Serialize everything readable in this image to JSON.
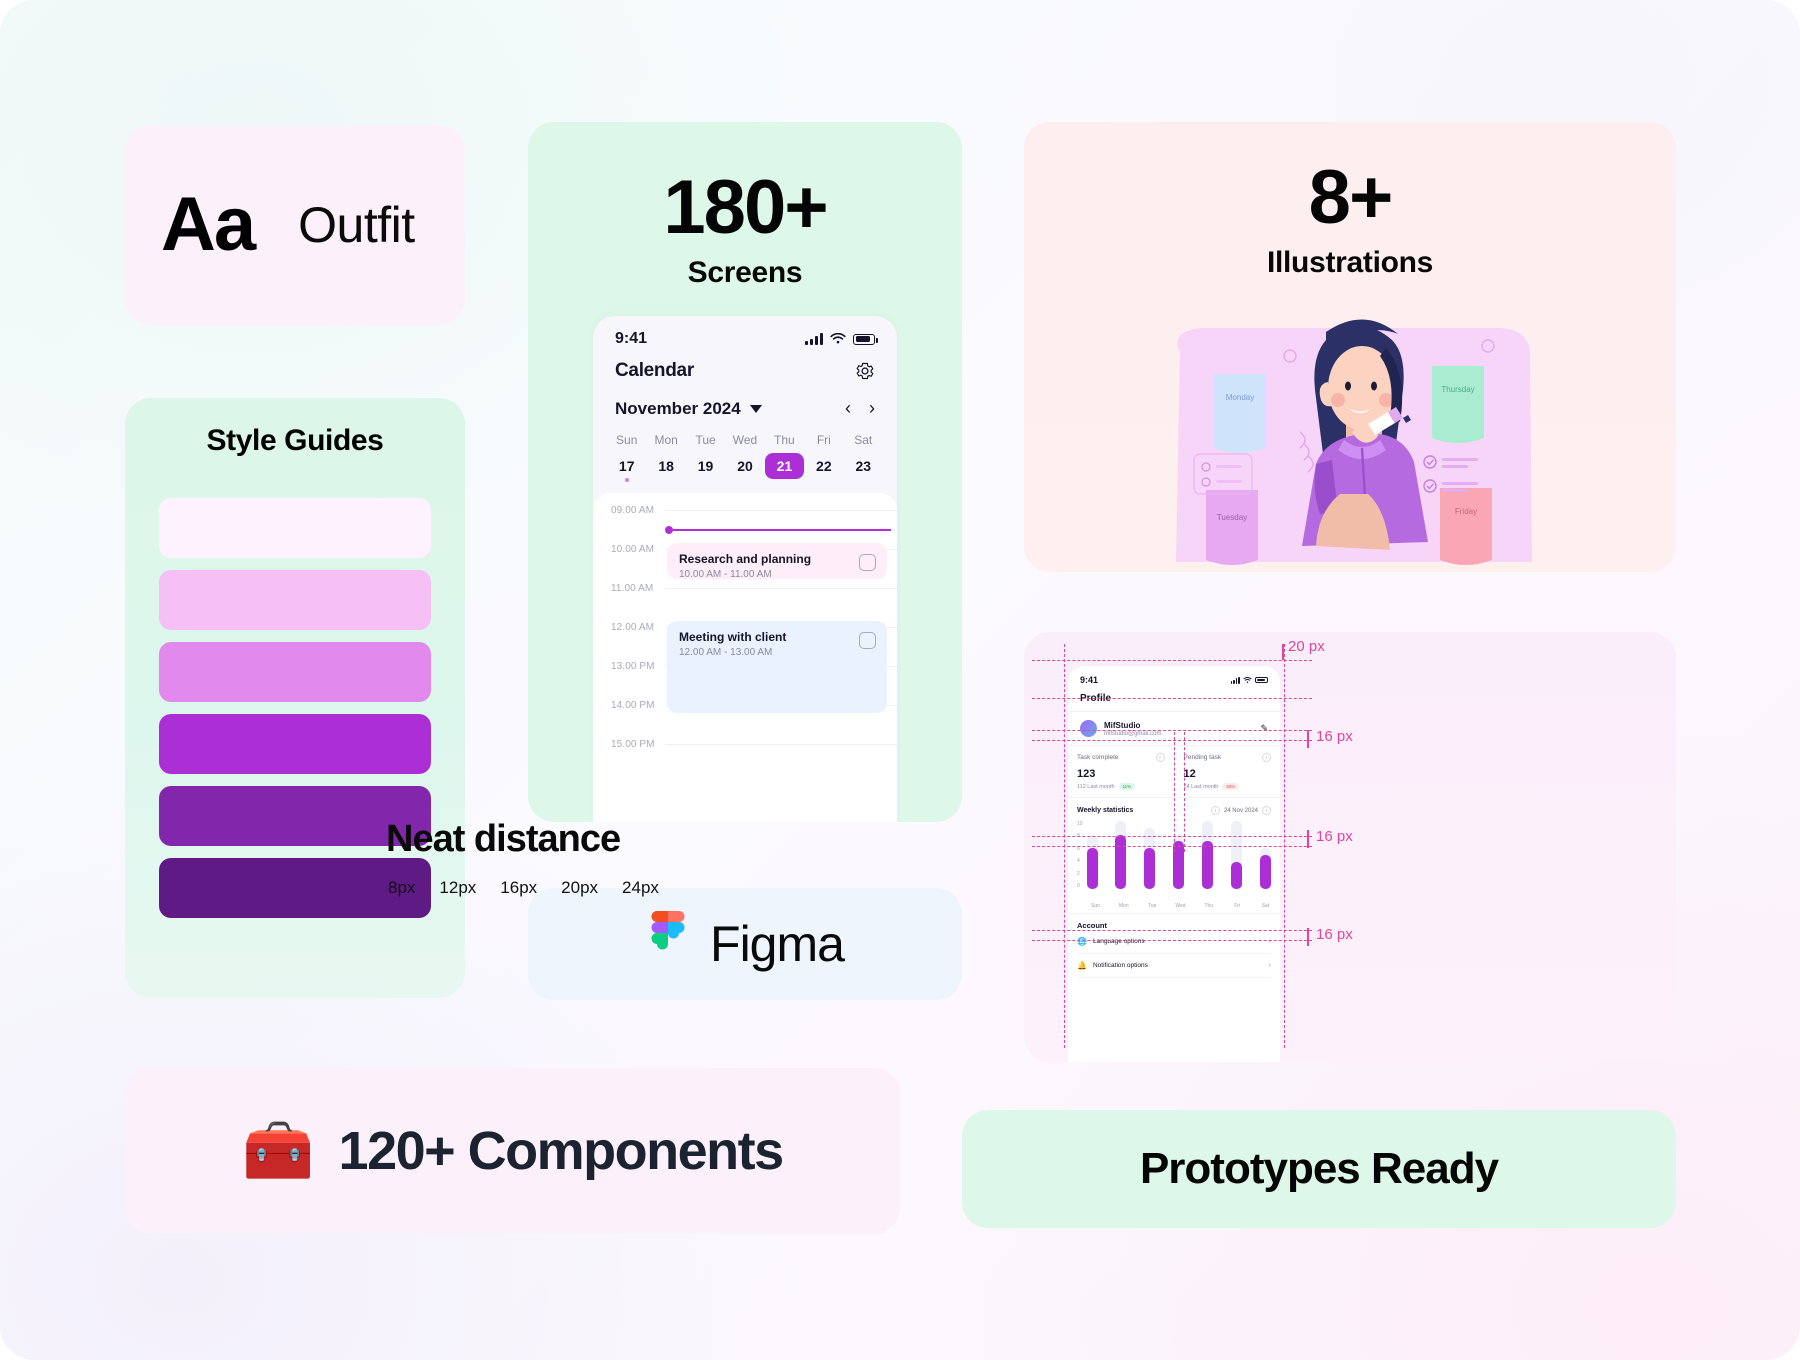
{
  "font_card": {
    "sample": "Aa",
    "name": "Outfit"
  },
  "style_card": {
    "title": "Style Guides",
    "swatches": [
      {
        "name": "purple-50",
        "hex": "#fdf2fd"
      },
      {
        "name": "purple-200",
        "hex": "#f6c0f6"
      },
      {
        "name": "purple-300",
        "hex": "#e189ec"
      },
      {
        "name": "purple-500",
        "hex": "#ab2fd5"
      },
      {
        "name": "purple-700",
        "hex": "#8227ab"
      },
      {
        "name": "purple-900",
        "hex": "#5f1a85"
      }
    ]
  },
  "screens_card": {
    "count": "180+",
    "label": "Screens",
    "phone": {
      "status": {
        "time": "9:41"
      },
      "title": "Calendar",
      "settings_icon": "gear-icon",
      "month": "November  2024",
      "day_names": [
        "Sun",
        "Mon",
        "Tue",
        "Wed",
        "Thu",
        "Fri",
        "Sat"
      ],
      "day_numbers": [
        "17",
        "18",
        "19",
        "20",
        "21",
        "22",
        "23"
      ],
      "selected_day": "21",
      "time_slots": [
        "09.00 AM",
        "10.00 AM",
        "11.00 AM",
        "12.00 AM",
        "13.00 PM",
        "14.00 PM",
        "15.00 PM"
      ],
      "events": [
        {
          "title": "Research and planning",
          "time": "10.00 AM - 11.00 AM",
          "color": "pink"
        },
        {
          "title": "Meeting with client",
          "time": "12.00 AM - 13.00 AM",
          "color": "blue"
        }
      ]
    }
  },
  "figma_card": {
    "label": "Figma",
    "logo": "figma-logo"
  },
  "illustrations_card": {
    "count": "8+",
    "label": "Illustrations",
    "sticky_notes": [
      "Monday",
      "Thursday",
      "Tuesday",
      "Friday"
    ]
  },
  "neat_card": {
    "title": "Neat distance",
    "spacing_values": [
      "8px",
      "12px",
      "16px",
      "20px",
      "24px"
    ],
    "annotations": [
      "20 px",
      "16 px",
      "16 px",
      "16 px"
    ],
    "phone": {
      "status": {
        "time": "9:41"
      },
      "title": "Profile",
      "user": {
        "name": "MifStudio",
        "email": "mifstudio@gmail.com",
        "edit_icon": "pencil-icon"
      },
      "stats": [
        {
          "label": "Task complete",
          "value": "123",
          "sub": "112 Last month",
          "delta": "11%",
          "direction": "up"
        },
        {
          "label": "Pending task",
          "value": "12",
          "sub": "24 Last month",
          "delta": "50%",
          "direction": "down"
        }
      ],
      "chart_title": "Weekly statistics",
      "chart_date": "24 Nov 2024",
      "account_title": "Account",
      "account_rows": [
        {
          "icon": "language-icon",
          "label": "Language options"
        },
        {
          "icon": "bell-icon",
          "label": "Notification options"
        }
      ]
    }
  },
  "chart_data": {
    "type": "bar",
    "title": "Weekly statistics",
    "categories": [
      "Sun",
      "Mon",
      "Tue",
      "Wed",
      "Thu",
      "Fri",
      "Sat"
    ],
    "values": [
      6,
      8,
      6,
      7,
      7,
      4,
      5
    ],
    "track_values": [
      8,
      10,
      9,
      8,
      10,
      10,
      6
    ],
    "ylabel": "",
    "xlabel": "",
    "ylim": [
      0,
      10
    ],
    "yticks": [
      "10",
      "8",
      "6",
      "4",
      "2",
      "0"
    ],
    "bar_color": "#ab2fd5",
    "track_color": "#eef0f8",
    "grid": false,
    "legend": "none"
  },
  "components_card": {
    "emoji": "🧰",
    "label": "120+ Components"
  },
  "prototypes_card": {
    "label": "Prototypes Ready"
  },
  "colors": {
    "accent_purple": "#ab2fd5",
    "mint": "#ddf8e9",
    "pink": "#fcf0fb",
    "peach": "#fdeeef",
    "blue": "#eef5fd",
    "guide_pink": "#e0459a"
  }
}
